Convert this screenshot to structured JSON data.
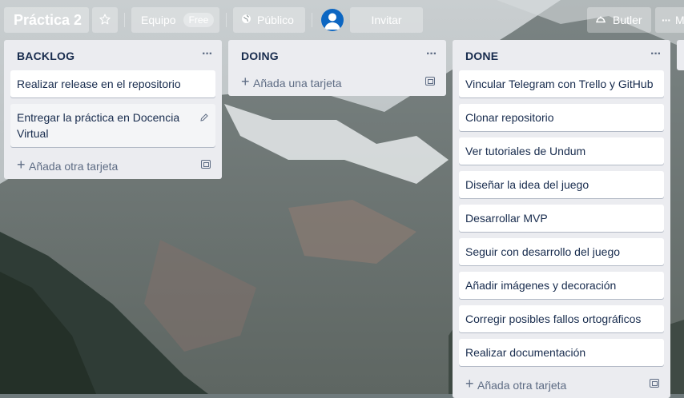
{
  "header": {
    "board_title": "Práctica 2",
    "star_icon": "star-icon",
    "team_label": "Equipo",
    "team_badge": "Free",
    "visibility_label": "Público",
    "visibility_icon": "globe-icon",
    "invite_label": "Invitar",
    "butler_label": "Butler",
    "butler_icon": "butler-icon",
    "more_label": "M"
  },
  "lists": [
    {
      "title": "BACKLOG",
      "cards": [
        "Realizar release en el repositorio",
        "Entregar la práctica en Docencia Virtual"
      ],
      "add_label": "Añada otra tarjeta"
    },
    {
      "title": "DOING",
      "cards": [],
      "add_label": "Añada una tarjeta"
    },
    {
      "title": "DONE",
      "cards": [
        "Vincular Telegram con Trello y GitHub",
        "Clonar repositorio",
        "Ver tutoriales de Undum",
        "Diseñar la idea del juego",
        "Desarrollar MVP",
        "Seguir con desarrollo del juego",
        "Añadir imágenes y decoración",
        "Corregir posibles fallos ortográficos",
        "Realizar documentación"
      ],
      "add_label": "Añada otra tarjeta"
    }
  ],
  "colors": {
    "list_bg": "#ebecf0",
    "card_bg": "#ffffff",
    "text": "#172b4d",
    "muted": "#5e6c84",
    "avatar": "#0c66c2"
  }
}
